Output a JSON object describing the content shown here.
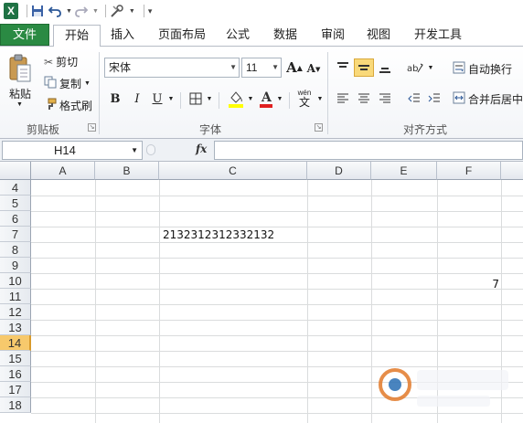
{
  "qat": {
    "app_icon": "X",
    "save_icon": "save-icon",
    "undo_icon": "undo-icon",
    "redo_icon": "redo-icon"
  },
  "tabs": [
    "文件",
    "开始",
    "插入",
    "页面布局",
    "公式",
    "数据",
    "审阅",
    "视图",
    "开发工具"
  ],
  "active_tab": "开始",
  "ribbon": {
    "clipboard": {
      "paste_label": "粘贴",
      "cut_label": "剪切",
      "copy_label": "复制",
      "format_painter_label": "格式刷",
      "group_label": "剪贴板"
    },
    "font": {
      "font_name": "宋体",
      "font_size": "11",
      "bold": "B",
      "italic": "I",
      "underline": "U",
      "grow_font": "A",
      "shrink_font": "A",
      "wen": "wén",
      "group_label": "字体"
    },
    "alignment": {
      "wrap_text_label": "自动换行",
      "merge_center_label": "合并后居中",
      "group_label": "对齐方式"
    }
  },
  "formula_bar": {
    "name_box": "H14",
    "fx_label": "fx",
    "formula": ""
  },
  "columns": [
    "A",
    "B",
    "C",
    "D",
    "E",
    "F"
  ],
  "rows": [
    "4",
    "5",
    "6",
    "7",
    "8",
    "9",
    "10",
    "11",
    "12",
    "13",
    "14",
    "15",
    "16",
    "17",
    "18"
  ],
  "selected_row": "14",
  "cells": {
    "C7": "2132312312332132",
    "F10": "7"
  },
  "colors": {
    "file_tab": "#2a8a43",
    "selected_row_header": "#f7c96c"
  }
}
